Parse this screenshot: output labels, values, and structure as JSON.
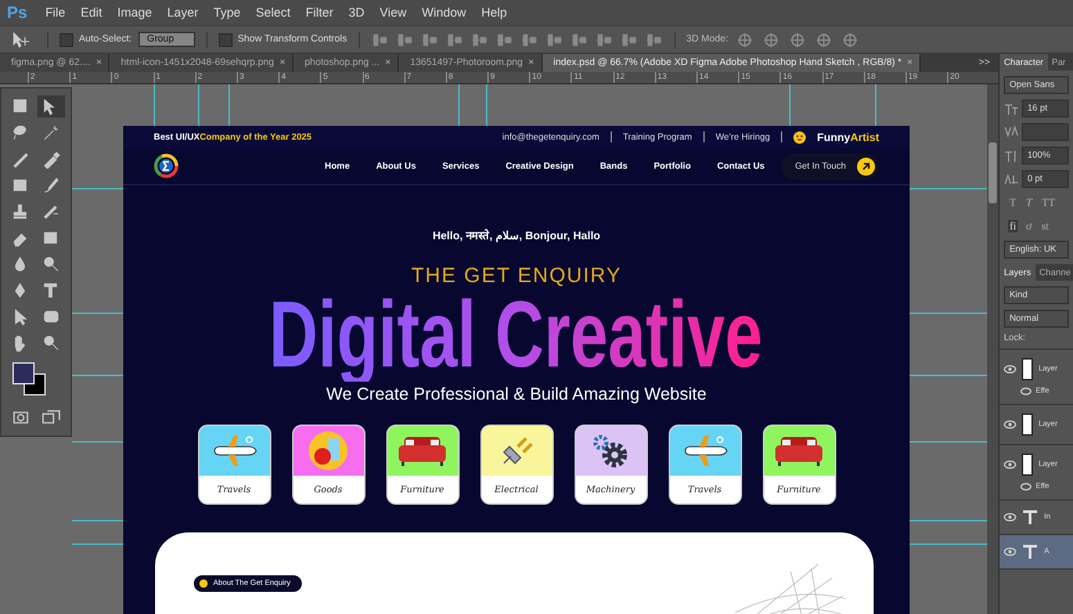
{
  "app_logo": "Ps",
  "menu": [
    "File",
    "Edit",
    "Image",
    "Layer",
    "Type",
    "Select",
    "Filter",
    "3D",
    "View",
    "Window",
    "Help"
  ],
  "options_bar": {
    "auto_select": {
      "label": "Auto-Select:",
      "checked": false
    },
    "group_select": "Group",
    "transform_controls": {
      "label": "Show Transform Controls",
      "checked": false
    },
    "mode_label": "3D Mode:"
  },
  "tabs": [
    {
      "label": "figma.png @ 62....",
      "close": "×",
      "selected": false
    },
    {
      "label": "html-icon-1451x2048-69sehqrp.png",
      "close": "×",
      "selected": false
    },
    {
      "label": "photoshop.png ...",
      "close": "×",
      "selected": false
    },
    {
      "label": "13651497-Photoroom.png",
      "close": "×",
      "selected": false
    },
    {
      "label": "index.psd @ 66.7% (Adobe XD Figma Adobe Photoshop Hand Sketch , RGB/8) *",
      "close": "×",
      "selected": true
    }
  ],
  "tabs_overflow": ">>",
  "ruler": [
    "2",
    "1",
    "0",
    "1",
    "2",
    "3",
    "4",
    "5",
    "6",
    "7",
    "8",
    "9",
    "10",
    "11",
    "12",
    "13",
    "14",
    "15",
    "16",
    "17",
    "18",
    "19",
    "20"
  ],
  "document": {
    "topbar": {
      "award_lead": "Best UI/UX",
      "award_rest": "Company of the Year 2025",
      "links": [
        "info@thegetenquiry.com",
        "Training Program",
        "We’re Hiringg"
      ],
      "brand_lead": "Funny",
      "brand_rest": "Artist"
    },
    "nav": {
      "items": [
        "Home",
        "About Us",
        "Services",
        "Creative Design",
        "Bands",
        "Portfolio",
        "Contact Us"
      ],
      "cta": "Get In Touch"
    },
    "hero": {
      "greeting": "Hello, नमस्ते, سلام, Bonjour, Hallo",
      "kicker": "THE GET ENQUIRY",
      "title": "Digital Creative",
      "subtitle": "We Create Professional & Build Amazing Website"
    },
    "categories": [
      {
        "label": "Travels",
        "kind": "plane",
        "color": "#66d4f5"
      },
      {
        "label": "Goods",
        "kind": "goods",
        "color": "#f66df0"
      },
      {
        "label": "Furniture",
        "kind": "sofa",
        "color": "#8ef55e"
      },
      {
        "label": "Electrical",
        "kind": "plug",
        "color": "#f8f59a"
      },
      {
        "label": "Machinery",
        "kind": "gears",
        "color": "#dcc3f5"
      },
      {
        "label": "Travels",
        "kind": "plane",
        "color": "#66d4f5"
      },
      {
        "label": "Furniture",
        "kind": "sofa",
        "color": "#8ef55e"
      }
    ],
    "about_pill": "About The Get Enquiry"
  },
  "character": {
    "tabs": [
      {
        "label": "Character",
        "selected": true
      },
      {
        "label": "Par",
        "selected": false
      }
    ],
    "font": "Open Sans",
    "size": "16 pt",
    "scale": "100%",
    "baseline": "0 pt",
    "style_buttons": [
      {
        "label": "T",
        "kind": "regular"
      },
      {
        "label": "T",
        "kind": "italic"
      },
      {
        "label": "TT",
        "kind": "caps"
      }
    ],
    "opentype": [
      {
        "label": "fi",
        "selected": true
      },
      {
        "label": "ơ",
        "selected": false
      },
      {
        "label": "st",
        "selected": false
      }
    ],
    "language": "English: UK"
  },
  "layers": {
    "tabs": [
      {
        "label": "Layers",
        "selected": true
      },
      {
        "label": "Channe",
        "selected": false
      }
    ],
    "filter": "Kind",
    "blend": "Normal",
    "lock": "Lock:",
    "items": [
      {
        "kind": "image",
        "name": "Layer",
        "effects": "Effe",
        "selected": false
      },
      {
        "kind": "image",
        "name": "Layer",
        "selected": false
      },
      {
        "kind": "image",
        "name": "Layer",
        "effects": "Effe",
        "selected": false
      },
      {
        "kind": "text",
        "name": "In",
        "selected": false
      },
      {
        "kind": "text",
        "name": "A",
        "selected": true
      }
    ]
  }
}
